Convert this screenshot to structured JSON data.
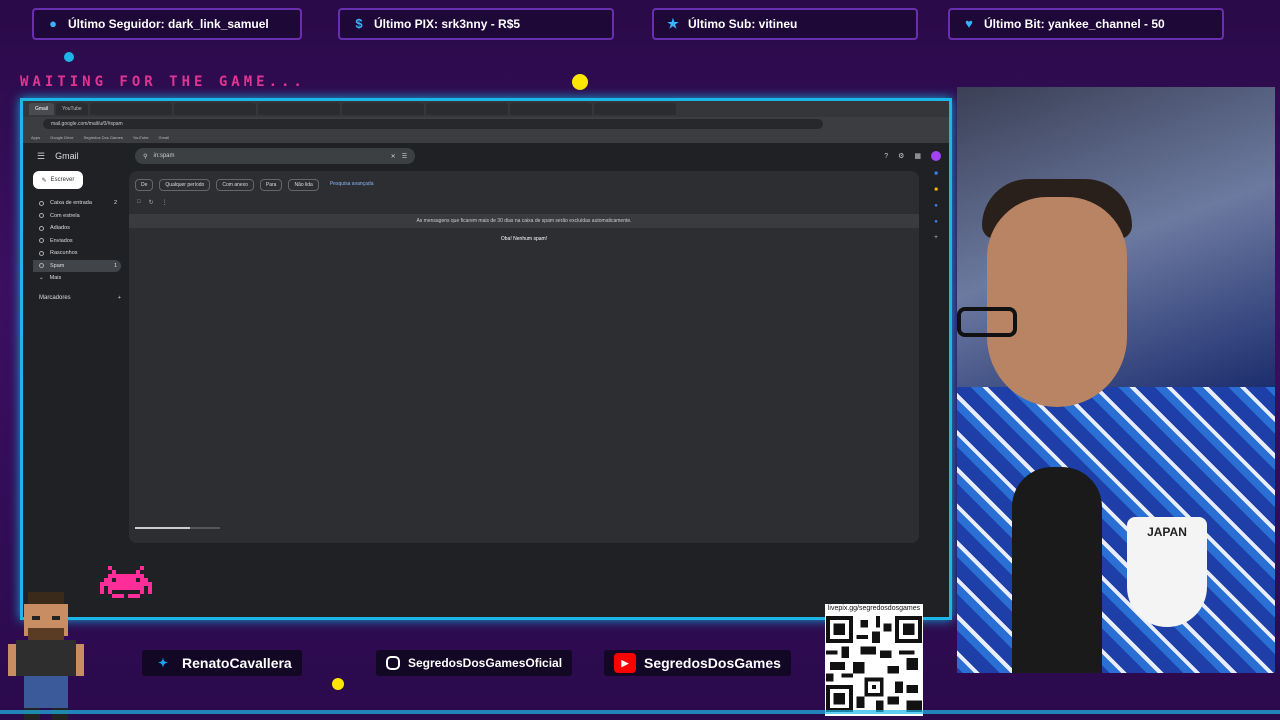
{
  "alerts": [
    {
      "icon": "user-icon",
      "label": "Último Seguidor: dark_link_samuel"
    },
    {
      "icon": "dollar-icon",
      "label": "Último PIX: srk3nny - R$5"
    },
    {
      "icon": "star-icon",
      "label": "Último Sub: vitineu"
    },
    {
      "icon": "heart-icon",
      "label": "Último Bit: yankee_channel - 50"
    }
  ],
  "overlay": {
    "waiting_text": "WAITING FOR THE GAME..."
  },
  "browser": {
    "tabs": [
      "Gmail",
      "YouTube",
      "",
      "",
      "",
      "",
      "",
      "",
      ""
    ],
    "active_tab": 0,
    "url": "mail.google.com/mail/u/0/#spam",
    "bookmarks": [
      "Apps",
      "Google Drive",
      "Segredos Dos Games",
      "YouTube",
      "Gmail"
    ]
  },
  "gmail": {
    "logo": "Gmail",
    "search_value": "in:spam",
    "compose_label": "Escrever",
    "nav": [
      {
        "label": "Caixa de entrada",
        "count": "2",
        "active": false
      },
      {
        "label": "Com estrela",
        "count": "",
        "active": false
      },
      {
        "label": "Adiados",
        "count": "",
        "active": false
      },
      {
        "label": "Enviados",
        "count": "",
        "active": false
      },
      {
        "label": "Rascunhos",
        "count": "",
        "active": false
      },
      {
        "label": "Spam",
        "count": "1",
        "active": true
      },
      {
        "label": "Mais",
        "count": "",
        "active": false
      }
    ],
    "labels_header": "Marcadores",
    "filter_chips": [
      "De",
      "Qualquer período",
      "Com anexo",
      "Para",
      "Não lida"
    ],
    "advanced_search": "Pesquisa avançada",
    "spam_notice": "As mensagens que ficarem mais de 30 dias na caixa de spam serão excluídas automaticamente.",
    "empty_text": "Oba! Nenhum spam!",
    "storage_fraction": 0.65
  },
  "social": [
    {
      "icon": "twitter-icon",
      "label": "RenatoCavallera",
      "color": "#1da1f2"
    },
    {
      "icon": "instagram-icon",
      "label": "SegredosDosGamesOficial",
      "color": "#c13584"
    },
    {
      "icon": "youtube-icon",
      "label": "SegredosDosGames",
      "color": "#ff0000"
    }
  ],
  "qr": {
    "caption": "livepix.gg/segredosdosgames"
  },
  "webcam": {
    "crest_text": "JAPAN"
  },
  "colors": {
    "accent": "#1cb6e8",
    "background": "#2a0a48",
    "waiting": "#ff3c9e",
    "invader": "#ff2d9a"
  }
}
